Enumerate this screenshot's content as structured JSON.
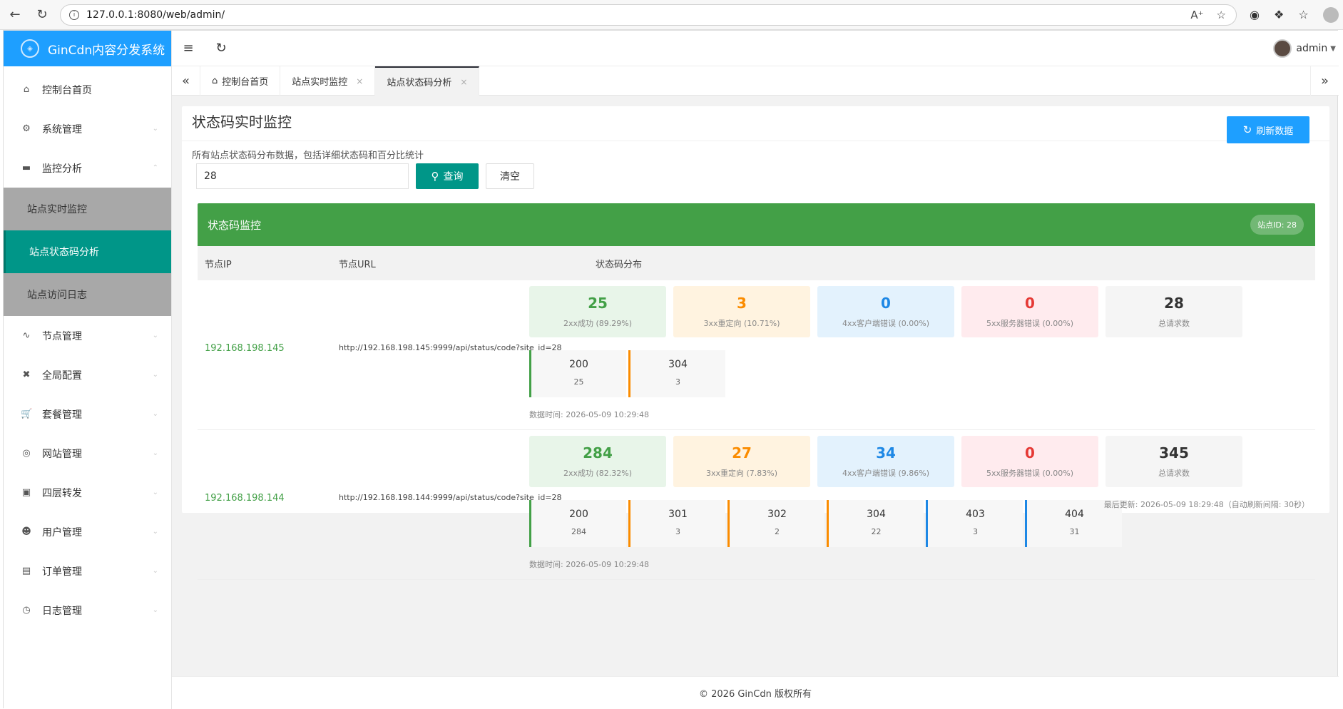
{
  "browser": {
    "url": "127.0.0.1:8080/web/admin/",
    "back_icon": "back-arrow-icon",
    "reload_icon": "reload-icon"
  },
  "brand": {
    "title": "GinCdn内容分发系统"
  },
  "sidebar": {
    "items": [
      {
        "label": "控制台首页",
        "icon": "home-icon"
      },
      {
        "label": "系统管理",
        "icon": "gear-icon"
      },
      {
        "label": "监控分析",
        "icon": "monitor-icon"
      },
      {
        "label": "节点管理",
        "icon": "pulse-icon"
      },
      {
        "label": "全局配置",
        "icon": "tools-icon"
      },
      {
        "label": "套餐管理",
        "icon": "cart-icon"
      },
      {
        "label": "网站管理",
        "icon": "globe-icon"
      },
      {
        "label": "四层转发",
        "icon": "cube-icon"
      },
      {
        "label": "用户管理",
        "icon": "user-icon"
      },
      {
        "label": "订单管理",
        "icon": "document-icon"
      },
      {
        "label": "日志管理",
        "icon": "clock-icon"
      }
    ],
    "submenu": [
      {
        "label": "站点实时监控"
      },
      {
        "label": "站点状态码分析"
      },
      {
        "label": "站点访问日志"
      }
    ]
  },
  "header": {
    "user": "admin"
  },
  "tabs": [
    {
      "label": "控制台首页"
    },
    {
      "label": "站点实时监控"
    },
    {
      "label": "站点状态码分析"
    }
  ],
  "page": {
    "title": "状态码实时监控",
    "subtitle": "所有站点状态码分布数据，包括详细状态码和百分比统计",
    "refresh_label": "刷新数据",
    "search_value": "28",
    "query_label": "查询",
    "clear_label": "清空",
    "panel_title": "状态码监控",
    "site_badge": "站点ID: 28",
    "columns": {
      "ip": "节点IP",
      "url": "节点URL",
      "dist": "状态码分布"
    },
    "last_update": "最后更新: 2026-05-09 18:29:48（自动刷新间隔: 30秒）"
  },
  "rows": [
    {
      "ip": "192.168.198.145",
      "url": "http://192.168.198.145:9999/api/status/code?site_id=28",
      "stats": [
        {
          "num": "25",
          "label": "2xx成功 (89.29%)"
        },
        {
          "num": "3",
          "label": "3xx重定向 (10.71%)"
        },
        {
          "num": "0",
          "label": "4xx客户端错误 (0.00%)"
        },
        {
          "num": "0",
          "label": "5xx服务器错误 (0.00%)"
        },
        {
          "num": "28",
          "label": "总请求数"
        }
      ],
      "codes": [
        {
          "code": "200",
          "count": "25"
        },
        {
          "code": "304",
          "count": "3"
        }
      ],
      "time": "数据时间: 2026-05-09 10:29:48"
    },
    {
      "ip": "192.168.198.144",
      "url": "http://192.168.198.144:9999/api/status/code?site_id=28",
      "stats": [
        {
          "num": "284",
          "label": "2xx成功 (82.32%)"
        },
        {
          "num": "27",
          "label": "3xx重定向 (7.83%)"
        },
        {
          "num": "34",
          "label": "4xx客户端错误 (9.86%)"
        },
        {
          "num": "0",
          "label": "5xx服务器错误 (0.00%)"
        },
        {
          "num": "345",
          "label": "总请求数"
        }
      ],
      "codes": [
        {
          "code": "200",
          "count": "284"
        },
        {
          "code": "301",
          "count": "3"
        },
        {
          "code": "302",
          "count": "2"
        },
        {
          "code": "304",
          "count": "22"
        },
        {
          "code": "403",
          "count": "3"
        },
        {
          "code": "404",
          "count": "31"
        }
      ],
      "time": "数据时间: 2026-05-09 10:29:48"
    }
  ],
  "footer": {
    "text": "© 2026 GinCdn 版权所有"
  },
  "colors": {
    "brand": "#1e9fff",
    "primary": "#009688",
    "success": "#43a047",
    "warning": "#fb8c00",
    "info": "#1e88e5",
    "danger": "#e53935"
  }
}
